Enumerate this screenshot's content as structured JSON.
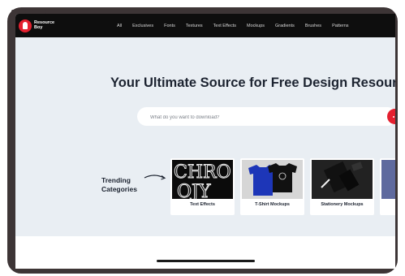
{
  "brand": {
    "name": "Resource Boy"
  },
  "nav": {
    "links": [
      "All",
      "Exclusives",
      "Fonts",
      "Textures",
      "Text Effects",
      "Mockups",
      "Gradients",
      "Brushes",
      "Patterns"
    ]
  },
  "hero": {
    "headline": "Your Ultimate Source for Free Design Resources",
    "search_placeholder": "What do you want to download?"
  },
  "trending": {
    "label": "Trending Categories",
    "cards": [
      {
        "caption": "Text Effects"
      },
      {
        "caption": "T-Shirt Mockups"
      },
      {
        "caption": "Stationery Mockups"
      },
      {
        "caption": ""
      }
    ]
  },
  "colors": {
    "accent": "#e4202f",
    "nav_bg": "#0e0e0e",
    "hero_bg": "#e9eef3",
    "frame": "#3d3536"
  }
}
